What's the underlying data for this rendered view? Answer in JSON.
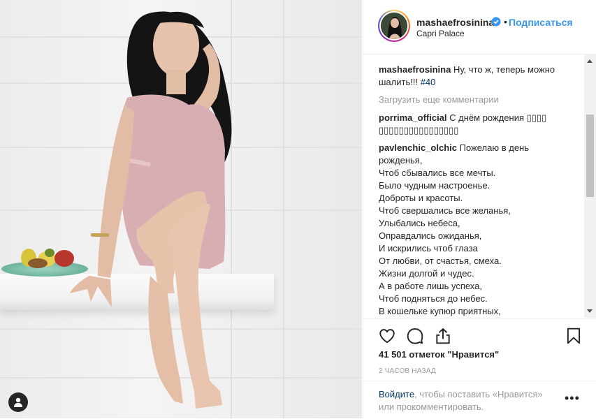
{
  "header": {
    "username": "mashaefrosinina",
    "separator": "•",
    "follow_label": "Подписаться",
    "location": "Capri Palace"
  },
  "caption": {
    "username": "mashaefrosinina",
    "text": "Ну, что ж, теперь можно шалить!!!",
    "hashtag": "#40"
  },
  "load_more": "Загрузить еще комментарии",
  "comments": [
    {
      "username": "porrima_official",
      "text": "С днём рождения ▯▯▯▯",
      "text_line2": "▯▯▯▯▯▯▯▯▯▯▯▯▯▯▯▯"
    },
    {
      "username": "pavlenchic_olchic",
      "text": "Пожелаю в день",
      "lines": [
        "рожденья,",
        "Чтоб сбывались все мечты.",
        "Было чудным настроенье.",
        "Доброты и красоты.",
        "Чтоб свершались все желанья,",
        "Улыбались небеса,",
        "Оправдались ожиданья,",
        "И искрились чтоб глаза",
        "От любви, от счастья, смеха.",
        "Жизни долгой и чудес.",
        "А в работе лишь успеха,",
        "Чтоб подняться до небес.",
        "В кошельке купюр приятных,"
      ]
    }
  ],
  "likes": "41 501 отметок \"Нравится\"",
  "time_ago": "2 ЧАСОВ НАЗАД",
  "login": {
    "link": "Войдите",
    "text": ", чтобы поставить «Нравится» или прокомментировать."
  },
  "more_label": "•••",
  "icons": {
    "like": "heart-icon",
    "comment": "comment-bubble-icon",
    "share": "share-icon",
    "save": "bookmark-icon",
    "verified": "verified-badge-icon",
    "user": "user-icon"
  },
  "colors": {
    "link_blue": "#3897f0",
    "hashtag_blue": "#003569",
    "muted": "#999999",
    "text": "#262626"
  }
}
